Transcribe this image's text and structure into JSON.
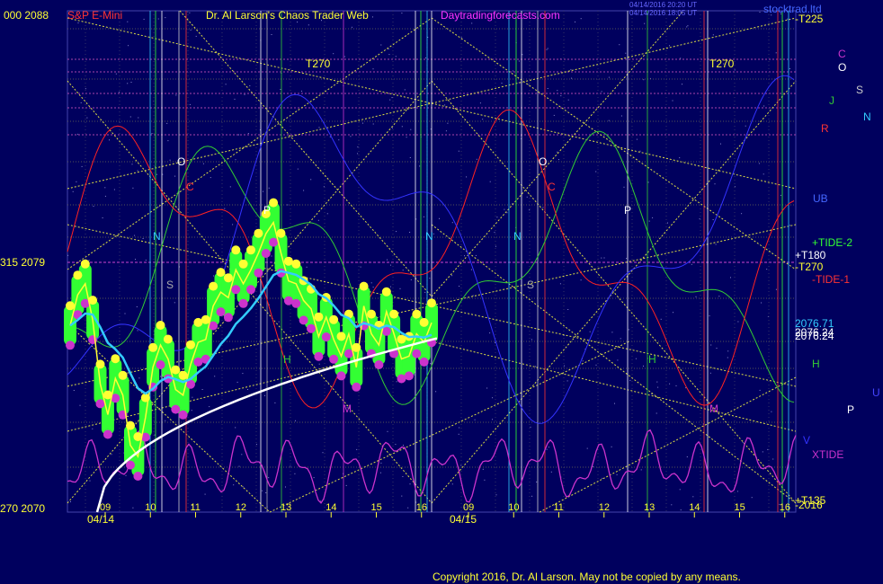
{
  "header": {
    "left_values": "000  2088",
    "instrument": "S&P E-Mini",
    "site_title": "Dr. Al Larson's Chaos Trader Web",
    "site_url": "Daytradingforecasts.com",
    "timestamp_1": "04/14/2016 20:20 UT",
    "timestamp_2": "04/14/2016 18:05 UT",
    "watermark": "stocktrad.ltd"
  },
  "left_axis": {
    "top": "000  2088",
    "mid": "315  2079",
    "bottom": "270  2070"
  },
  "right_labels": {
    "t225": "-T225",
    "tide2": "+TIDE-2",
    "t180": "+T180",
    "t270": "-T270",
    "tide1": "-TIDE-1",
    "price1": "2076.71",
    "price2": "2076.24",
    "price3": "2076.24",
    "h": "H",
    "p": "P",
    "u": "U",
    "v": "V",
    "xtide": "XTIDE",
    "ub": "UB",
    "n": "N",
    "s": "S",
    "j": "J",
    "r": "R",
    "c": "C",
    "o": "O",
    "t135": "+T135",
    "p2016": "-2016"
  },
  "annotations": {
    "t270_a": "T270",
    "t270_b": "T270",
    "o1": "O",
    "o2": "O",
    "c1": "C",
    "c2": "C",
    "p1": "P",
    "p2": "P",
    "n1": "N",
    "n2": "N",
    "n3": "N",
    "s1": "S",
    "s2": "S",
    "h1": "H",
    "h2": "H",
    "m1": "M",
    "m2": "M"
  },
  "x_axis": {
    "day1_label": "04/14",
    "day2_label": "04/15",
    "hours_day1": [
      "09",
      "10",
      "11",
      "12",
      "13",
      "14",
      "15",
      "16"
    ],
    "hours_day2": [
      "09",
      "10",
      "11",
      "12",
      "13",
      "14",
      "15",
      "16"
    ]
  },
  "copyright": "Copyright 2016, Dr. Al Larson. May not be copied by any means.",
  "colors": {
    "background": "#00005e",
    "price_green": "#33ff33",
    "price_yellow": "#ffff33",
    "price_magenta": "#cc33cc",
    "cyan_ma": "#33ccff",
    "white_ma": "#ffffff",
    "red_flux": "#ff2222",
    "green_flux": "#33cc33",
    "blue_flux": "#3333ff",
    "xtide": "#cc33cc"
  },
  "chart_data": {
    "type": "line",
    "ylim": [
      2070,
      2088
    ],
    "price_close": [
      2076.7,
      2077.8,
      2078.2,
      2076.9,
      2074.6,
      2073.5,
      2074.8,
      2074.2,
      2072.4,
      2072.0,
      2073.4,
      2075.2,
      2076.0,
      2075.5,
      2074.4,
      2074.2,
      2075.3,
      2076.1,
      2076.2,
      2077.4,
      2077.9,
      2077.7,
      2078.7,
      2078.2,
      2078.7,
      2079.3,
      2080.0,
      2080.4,
      2079.3,
      2078.3,
      2078.2,
      2077.6,
      2077.3,
      2076.3,
      2077.0,
      2076.2,
      2075.6,
      2076.4,
      2075.2,
      2077.4,
      2076.4,
      2076.0,
      2077.2,
      2076.4,
      2075.5,
      2075.6,
      2076.4,
      2076.1,
      2076.8
    ],
    "cyan_ma_last": 2076.71,
    "white_ma_last": 2076.24
  }
}
